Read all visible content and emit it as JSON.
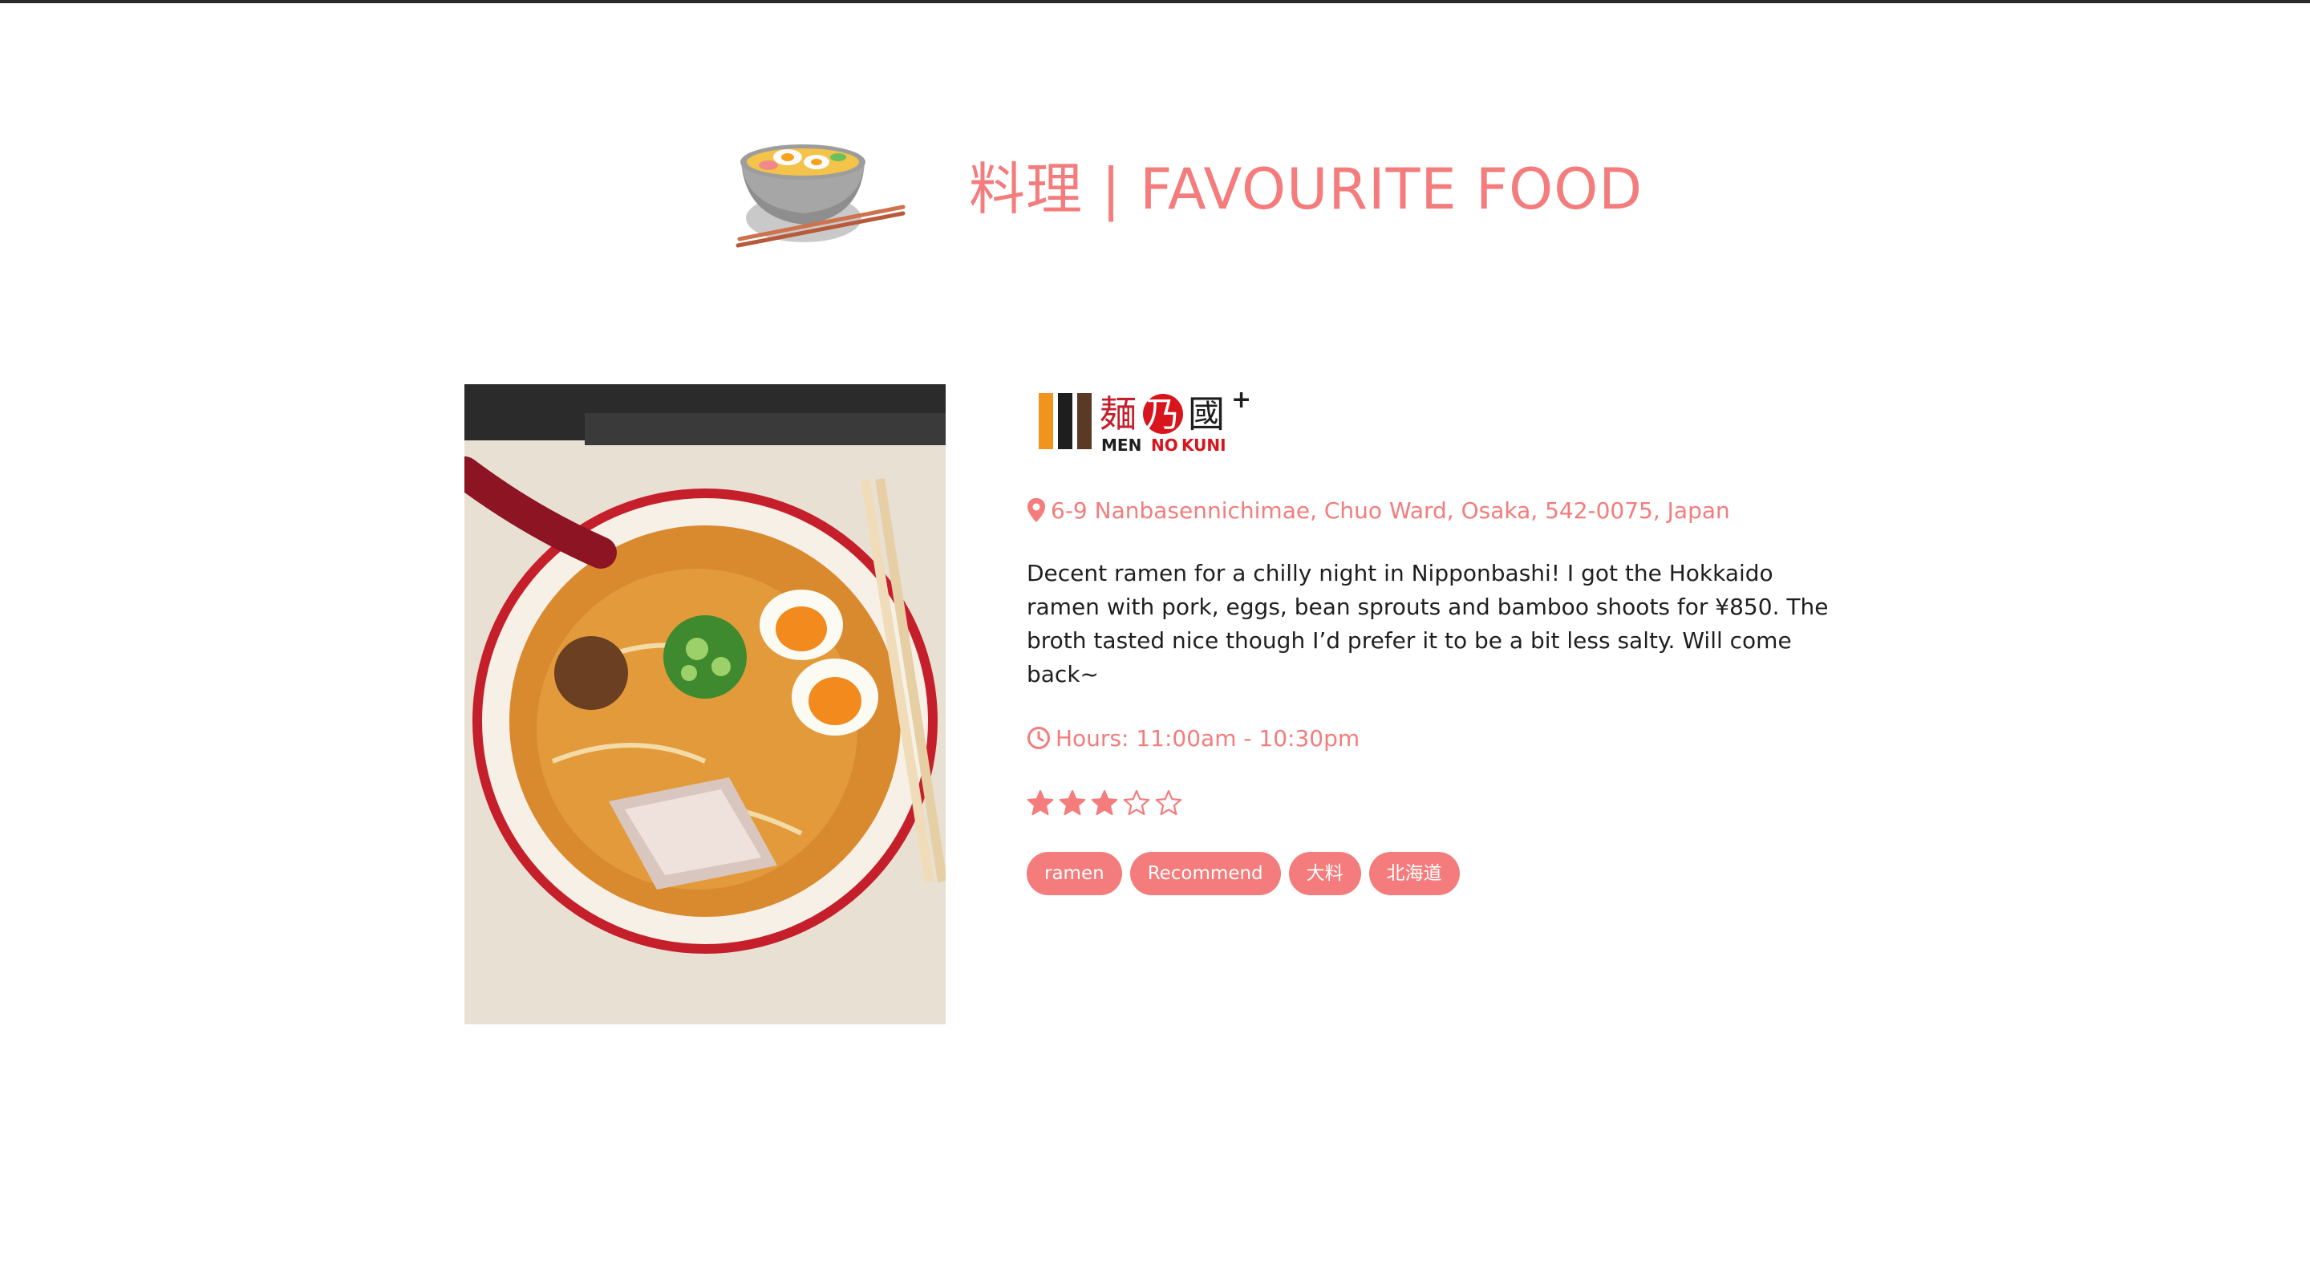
{
  "header": {
    "title": "料理 | FAVOURITE FOOD",
    "icon": "ramen-bowl-icon"
  },
  "restaurant": {
    "logo": {
      "kanji_1": "麺",
      "kanji_2": "乃",
      "kanji_3": "國",
      "plus": "+",
      "romaji_1": "MEN",
      "romaji_2": "NO",
      "romaji_3": "KUNI"
    },
    "address": "6-9 Nanbasennichimae, Chuo Ward, Osaka, 542-0075, Japan",
    "description": "Decent ramen for a chilly night in Nipponbashi! I got the Hokkaido ramen with pork, eggs, bean sprouts and bamboo shoots for ¥850. The broth tasted nice though I’d prefer it to be a bit less salty. Will come back~",
    "hours": "Hours: 11:00am - 10:30pm",
    "rating": 3,
    "rating_max": 5,
    "tags": [
      "ramen",
      "Recommend",
      "大料",
      "北海道"
    ]
  },
  "colors": {
    "accent": "#f47c7c",
    "text": "#1f1f1f"
  }
}
